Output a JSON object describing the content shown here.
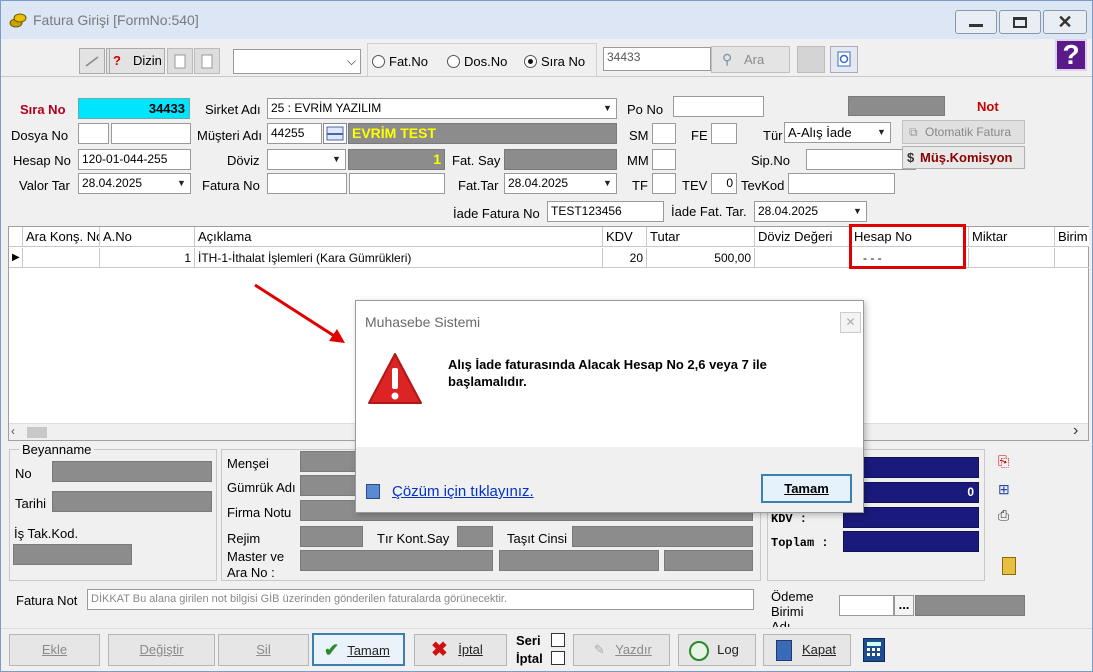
{
  "window": {
    "title": "Fatura Girişi [FormNo:540]"
  },
  "toolbar": {
    "dizin_label": "Dizin",
    "search_select_value": "",
    "radios": [
      {
        "label": "Fat.No",
        "checked": false
      },
      {
        "label": "Dos.No",
        "checked": false
      },
      {
        "label": "Sıra No",
        "checked": true
      }
    ],
    "search_value": "34433",
    "search_button_label": "Ara"
  },
  "header": {
    "sira_no_label": "Sıra No",
    "sira_no_value": "34433",
    "sirket_adi_label": "Sirket Adı",
    "sirket_adi_value": "25 : EVRİM YAZILIM",
    "po_no_label": "Po No",
    "po_no_value": "",
    "not_label": "Not",
    "dosya_no_label": "Dosya No",
    "musteri_adi_label": "Müşteri Adı",
    "musteri_code": "44255",
    "musteri_name": "EVRİM TEST",
    "sm_label": "SM",
    "fe_label": "FE",
    "tur_label": "Tür",
    "tur_value": "A-Alış İade",
    "otomatik_fatura_label": "Otomatik Fatura",
    "hesap_no_label": "Hesap No",
    "hesap_no_value": "120-01-044-255",
    "doviz_label": "Döviz",
    "doviz_value": "",
    "kur_value": "1",
    "fat_say_label": "Fat. Say",
    "mm_label": "MM",
    "sip_no_label": "Sip.No",
    "mus_komisyon_label": "Müş.Komisyon",
    "valor_tar_label": "Valor Tar",
    "valor_tar_value": "28.04.2025",
    "fatura_no_label": "Fatura No",
    "fat_tar_label": "Fat.Tar",
    "fat_tar_value": "28.04.2025",
    "tf_label": "TF",
    "tev_label": "TEV",
    "tev_value": "0",
    "tevkod_label": "TevKod",
    "iade_fatura_no_label": "İade Fatura No",
    "iade_fatura_no_value": "TEST123456",
    "iade_fat_tar_label": "İade Fat. Tar.",
    "iade_fat_tar_value": "28.04.2025"
  },
  "grid": {
    "columns": [
      "Ara Konş. No",
      "A.No",
      "Açıklama",
      "KDV",
      "Tutar",
      "Döviz Değeri",
      "Hesap No",
      "Miktar",
      "Birim"
    ],
    "rows": [
      {
        "ara_kons_no": "",
        "a_no": "1",
        "aciklama": "İTH-1-İthalat İşlemleri  (Kara Gümrükleri)",
        "kdv": "20",
        "tutar": "500,00",
        "doviz_degeri": "",
        "hesap_no": "- - -",
        "miktar": "",
        "birim": ""
      }
    ]
  },
  "beyanname": {
    "group_label": "Beyanname",
    "no_label": "No",
    "tarihi_label": "Tarihi",
    "is_tak_kod_label": "İş Tak.Kod."
  },
  "details": {
    "mensei_label": "Menşei",
    "gumruk_adi_label": "Gümrük Adı",
    "firma_notu_label": "Firma Notu",
    "rejim_label": "Rejim",
    "tir_kont_say_label": "Tır Kont.Say",
    "tasit_cinsi_label": "Taşıt Cinsi",
    "master_ve_ara_no_label": "Master ve\nAra No :"
  },
  "totals": {
    "second_value": "0",
    "kdv_label": "KDV :",
    "toplam_label": "Toplam :"
  },
  "fatura_not": {
    "label": "Fatura Not",
    "placeholder": "DİKKAT Bu alana girilen not bilgisi GİB üzerinden gönderilen faturalarda görünecektir."
  },
  "odeme": {
    "label": "Ödeme\nBirimi\nAdı",
    "button_label": "..."
  },
  "bottom_buttons": {
    "ekle": "Ekle",
    "degistir": "Değiştir",
    "sil": "Sil",
    "tamam": "Tamam",
    "iptal": "İptal",
    "seri": "Seri",
    "iptal_chk": "İptal",
    "yazdir": "Yazdır",
    "log": "Log",
    "kapat": "Kapat"
  },
  "dialog": {
    "title": "Muhasebe Sistemi",
    "message": "Alış İade faturasında Alacak Hesap No 2,6 veya 7 ile başlamalıdır.",
    "help_link": "Çözüm için tıklayınız.",
    "ok_label": "Tamam"
  },
  "colors": {
    "sira_no_bg": "#00e5ff",
    "sira_no_label": "#b0001e",
    "musteri_name_text": "#ffff00",
    "highlight_box": "#e00000",
    "total_fields": "#1a1a7c"
  }
}
